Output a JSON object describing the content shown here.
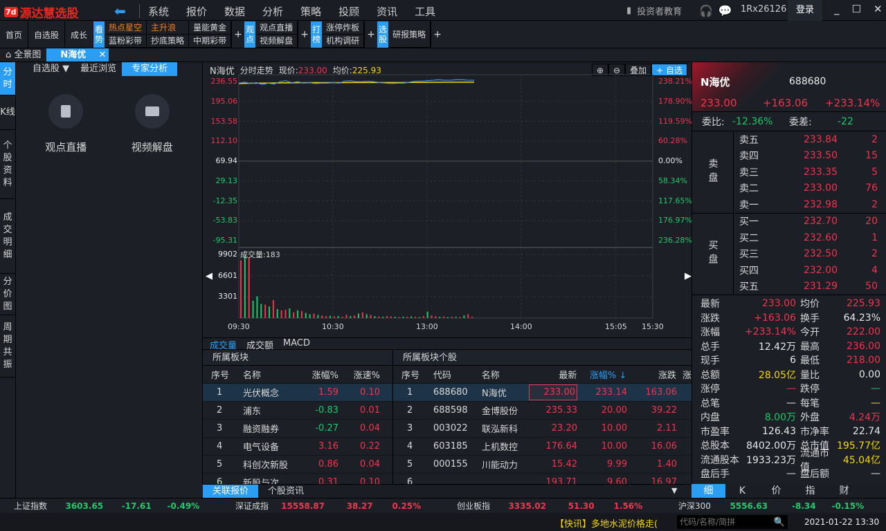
{
  "app": {
    "name": "源达慧选股",
    "logo_badge": "7d",
    "menu": [
      "系统",
      "报价",
      "数据",
      "分析",
      "策略",
      "投顾",
      "资讯",
      "工具"
    ],
    "edu": "投资者教育",
    "user_id": "1Rx26126",
    "login": "登录"
  },
  "toolbar": {
    "items": [
      "首页",
      "自选股",
      "成长"
    ],
    "groups": [
      {
        "tag": "看势",
        "cols": [
          [
            "热点星空",
            "蓝粉彩带"
          ],
          [
            "主升浪",
            "抄底策略"
          ],
          [
            "量能黄金",
            "中期彩带"
          ]
        ]
      },
      {
        "tag": "观点",
        "cols": [
          [
            "观点直播",
            "视频解盘"
          ]
        ]
      },
      {
        "tag": "打榜",
        "cols": [
          [
            "涨停炸板",
            "机构调研"
          ]
        ]
      },
      {
        "tag": "选股",
        "cols": [
          [
            "研报策略"
          ]
        ]
      }
    ]
  },
  "tabs": {
    "home": "全景图",
    "active": "N海优",
    "close": "✕"
  },
  "vtabs": [
    "分时",
    "K线",
    "个股资料",
    "成交明细",
    "分价图",
    "周期共振"
  ],
  "leftpanel": {
    "tabs": [
      "自选股 ▼",
      "最近浏览",
      "专家分析"
    ],
    "items": [
      "观点直播",
      "视频解盘"
    ]
  },
  "chart": {
    "name": "N海优",
    "mode": "分时走势",
    "price_label": "现价:",
    "price": "233.00",
    "avg_label": "均价:",
    "avg": "225.93",
    "btns": [
      "叠加",
      "+ 自选"
    ],
    "left_ticks": [
      "236.55",
      "195.06",
      "153.58",
      "112.10",
      "69.94",
      "29.13",
      "-12.35",
      "-53.83",
      "-95.31"
    ],
    "right_ticks": [
      "238.21%",
      "178.90%",
      "119.59%",
      "60.28%",
      "0.00%",
      "58.34%",
      "117.65%",
      "176.97%",
      "236.28%"
    ],
    "vol_label": "成交量:183",
    "vol_ticks": [
      "9902",
      "6601",
      "3301"
    ],
    "time_ticks": [
      "09:30",
      "10:30",
      "13:00",
      "14:00",
      "15:05",
      "15:30"
    ],
    "price_series": [
      229,
      231,
      228,
      230,
      226,
      229,
      227,
      232,
      234,
      230,
      232,
      229,
      230,
      228,
      229,
      229,
      230,
      229,
      233,
      234,
      232,
      232,
      233,
      232,
      230,
      229,
      228,
      229,
      229,
      231,
      233,
      233,
      234,
      235,
      236,
      235,
      235,
      236,
      236,
      235,
      235
    ],
    "avg_series": [
      228,
      228.5,
      228.8,
      229,
      229,
      229.2,
      229.3,
      229.5,
      229.6,
      229.7,
      229.8,
      229.9,
      230,
      230,
      230,
      230,
      230,
      230,
      230.1,
      230.2,
      230.2,
      230.3,
      230.3,
      230.3,
      230.3,
      230.3,
      230.3,
      230.3,
      230.3,
      230.4,
      230.5,
      230.5,
      230.6,
      230.7,
      230.8,
      230.9,
      231,
      231,
      231,
      231,
      231
    ],
    "volume_series": [
      9000,
      9800,
      9500,
      2700,
      3400,
      2200,
      2100,
      1800,
      2800,
      1400,
      1200,
      1300,
      1500,
      900,
      1200,
      1100,
      800,
      600,
      700,
      500,
      400,
      300,
      350,
      250,
      300,
      200,
      500,
      300,
      400,
      700,
      900,
      600,
      500,
      300,
      250,
      200,
      300,
      250,
      200,
      150,
      200,
      180,
      250,
      200,
      150,
      300,
      1000,
      400,
      300,
      200,
      250,
      150,
      200,
      180,
      150,
      400,
      600,
      200
    ],
    "volume_colors": "rgrgggrgrgrrgrgrggrgrrgrgrrgrgrgrgrgrrgrgrgrgrgrrgrgrgrgr",
    "colors": {
      "price_line": "#4a90e2",
      "avg_line": "#f5d90a",
      "up": "#f2344e",
      "down": "#1fca6a"
    }
  },
  "ctabs": [
    "成交量",
    "成交额",
    "MACD"
  ],
  "sector": {
    "title": "所属板块",
    "headers": [
      "序号",
      "名称",
      "涨幅%",
      "涨速%"
    ],
    "rows": [
      [
        "1",
        "光伏概念",
        "1.59",
        "0.10"
      ],
      [
        "2",
        "浦东",
        "-0.83",
        "0.01"
      ],
      [
        "3",
        "融资融券",
        "-0.27",
        "0.04"
      ],
      [
        "4",
        "电气设备",
        "3.16",
        "0.22"
      ],
      [
        "5",
        "科创次新股",
        "0.86",
        "0.04"
      ],
      [
        "6",
        "新股与次",
        "0.31",
        "0.10"
      ]
    ]
  },
  "stocks": {
    "title": "所属板块个股",
    "headers": [
      "序号",
      "代码",
      "名称",
      "最新",
      "涨幅% ↓",
      "涨跌",
      "涨"
    ],
    "rows": [
      [
        "1",
        "688680",
        "N海优",
        "233.00",
        "233.14",
        "163.06"
      ],
      [
        "2",
        "688598",
        "金博股份",
        "235.33",
        "20.00",
        "39.22"
      ],
      [
        "3",
        "003022",
        "联泓新科",
        "23.20",
        "10.00",
        "2.11"
      ],
      [
        "4",
        "603185",
        "上机数控",
        "176.64",
        "10.00",
        "16.06"
      ],
      [
        "5",
        "000155",
        "川能动力",
        "15.42",
        "9.99",
        "1.40"
      ],
      [
        "6",
        "",
        "",
        "193.71",
        "9.60",
        "16.97"
      ]
    ]
  },
  "btabs": [
    "关联报价",
    "个股资讯"
  ],
  "quote": {
    "name": "N海优",
    "code": "688680",
    "price": "233.00",
    "change": "+163.06",
    "pct": "+233.14%",
    "wb_label": "委比:",
    "wb": "-12.36%",
    "wc_label": "委差:",
    "wc": "-22",
    "sell_label": "卖盘",
    "buy_label": "买盘",
    "sell": [
      [
        "卖五",
        "233.84",
        "2"
      ],
      [
        "卖四",
        "233.50",
        "15"
      ],
      [
        "卖三",
        "233.35",
        "5"
      ],
      [
        "卖二",
        "233.00",
        "76"
      ],
      [
        "卖一",
        "232.98",
        "2"
      ]
    ],
    "buy": [
      [
        "买一",
        "232.70",
        "20"
      ],
      [
        "买二",
        "232.60",
        "1"
      ],
      [
        "买三",
        "232.50",
        "2"
      ],
      [
        "买四",
        "232.00",
        "4"
      ],
      [
        "买五",
        "231.29",
        "50"
      ]
    ],
    "stats": [
      [
        "最新",
        "233.00",
        "red",
        "均价",
        "225.93",
        "red"
      ],
      [
        "涨跌",
        "+163.06",
        "red",
        "换手",
        "64.23%",
        "white"
      ],
      [
        "涨幅",
        "+233.14%",
        "red",
        "今开",
        "222.00",
        "red"
      ],
      [
        "总手",
        "12.42万",
        "white",
        "最高",
        "236.00",
        "red"
      ],
      [
        "现手",
        "6",
        "white",
        "最低",
        "218.00",
        "red"
      ],
      [
        "总额",
        "28.05亿",
        "yellow",
        "量比",
        "0.00",
        "white"
      ],
      [
        "涨停",
        "—",
        "red",
        "跌停",
        "—",
        "green"
      ],
      [
        "总笔",
        "—",
        "white",
        "每笔",
        "—",
        "yellow"
      ],
      [
        "内盘",
        "8.00万",
        "green",
        "外盘",
        "4.24万",
        "red"
      ],
      [
        "市盈率",
        "126.43",
        "white",
        "市净率",
        "22.74",
        "white"
      ],
      [
        "总股本",
        "8402.00万",
        "white",
        "总市值",
        "195.77亿",
        "yellow"
      ],
      [
        "流通股本",
        "1933.23万",
        "white",
        "流通市值",
        "45.04亿",
        "yellow"
      ],
      [
        "盘后手",
        "—",
        "white",
        "盘后额",
        "—",
        "white"
      ]
    ],
    "tabs": [
      "细",
      "K",
      "价",
      "指",
      "财"
    ]
  },
  "status": [
    [
      "上证指数",
      "3603.65",
      "-17.61",
      "-0.49%",
      "green"
    ],
    [
      "深证成指",
      "15558.87",
      "38.27",
      "0.25%",
      "red"
    ],
    [
      "创业板指",
      "3335.02",
      "51.30",
      "1.56%",
      "red"
    ],
    [
      "沪深300",
      "5556.63",
      "-8.34",
      "-0.15%",
      "green"
    ]
  ],
  "footer": {
    "news": "【快讯】多地水泥价格走(",
    "search_placeholder": "代码/名称/简拼",
    "datetime": "2021-01-22 13:30"
  }
}
